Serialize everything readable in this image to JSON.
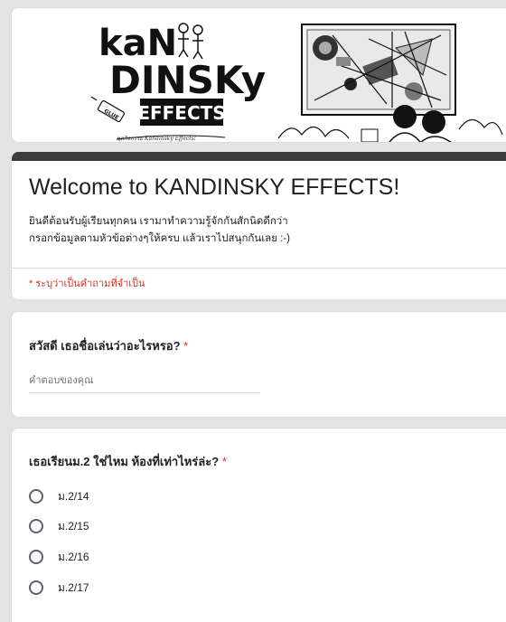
{
  "header": {
    "logo_text": "KANDINSKY EFFECTS",
    "logo_caption": "ชุดกิจกรรม Kandinsky Effects!"
  },
  "form": {
    "title": "Welcome to KANDINSKY EFFECTS!",
    "description_line1": "ยินดีต้อนรับผู้เรียนทุกคน เรามาทำความรู้จักกันสักนิดดีกว่า",
    "description_line2": "กรอกข้อมูลตามหัวข้อต่างๆให้ครบ แล้วเราไปสนุกกันเลย :-)",
    "required_note": "* ระบุว่าเป็นคำถามที่จำเป็น"
  },
  "questions": [
    {
      "title": "สวัสดี เธอชื่อเล่นว่าอะไรหรอ?",
      "required_mark": "*",
      "type": "short_answer",
      "placeholder": "คำตอบของคุณ",
      "value": ""
    },
    {
      "title": "เธอเรียนม.2 ใช่ไหม ห้องที่เท่าไหร่ล่ะ?",
      "required_mark": "*",
      "type": "radio",
      "options": [
        "ม.2/14",
        "ม.2/15",
        "ม.2/16",
        "ม.2/17"
      ]
    }
  ],
  "colors": {
    "page_background": "#e4e4e4",
    "title_accent": "#3c3c3c",
    "required": "#d93025"
  }
}
